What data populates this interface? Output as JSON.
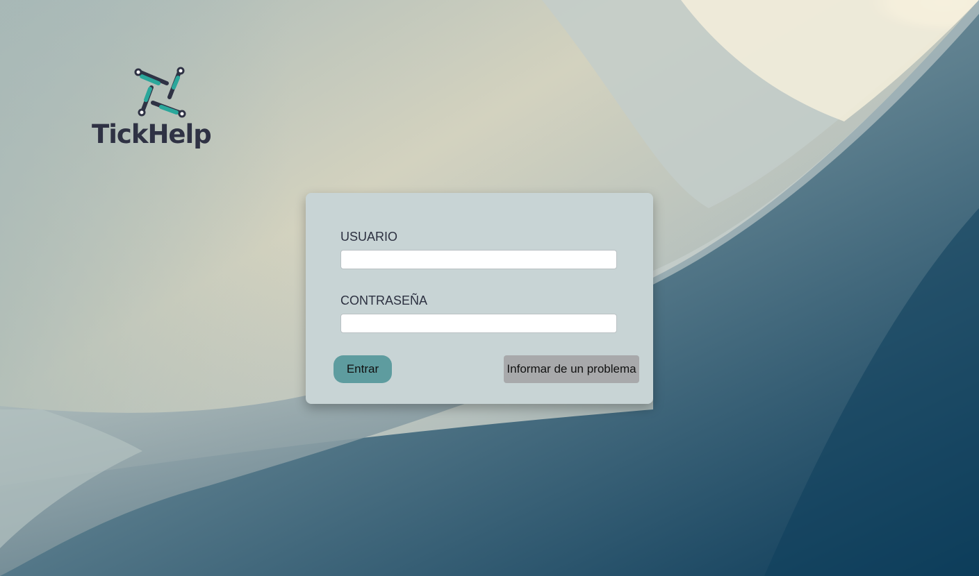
{
  "brand": {
    "name": "TickHelp",
    "logo_icon": "tickhelp-logo-icon",
    "text_color": "#2f3244",
    "accent_color": "#2aa79b"
  },
  "login": {
    "user_label": "USUARIO",
    "user_value": "",
    "password_label": "CONTRASEÑA",
    "password_value": "",
    "submit_label": "Entrar",
    "report_label": "Informar de un problema"
  },
  "colors": {
    "card_background": "#c8d4d5",
    "submit_button": "#5e9c9f",
    "report_button": "#a8a9ab"
  }
}
